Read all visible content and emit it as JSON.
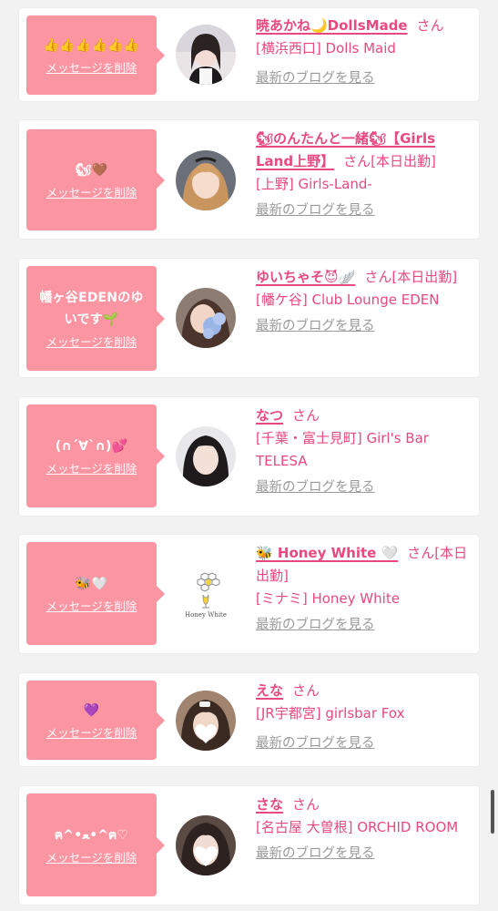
{
  "common": {
    "delete_label": "メッセージを削除",
    "san": "さん",
    "blog_link": "最新のブログを見る"
  },
  "items": [
    {
      "message": "👍👍👍👍👍👍",
      "name": "暁あかね🌙DollsMade",
      "status": "",
      "shop": "[横浜西口] Dolls Maid"
    },
    {
      "message": "🐿🤎",
      "name": "🐿のんたんと一緒🐿【Girls Land上野】",
      "status": "[本日出勤]",
      "shop": "[上野] Girls-Land-"
    },
    {
      "message": "幡ヶ谷EDENのゆいです🌱",
      "name": "ゆいちゃそ😈🪽",
      "status": "[本日出勤]",
      "shop": "[幡ケ谷] Club Lounge EDEN"
    },
    {
      "message": "(∩´∀`∩)💕",
      "name": "なつ",
      "status": "",
      "shop": "[千葉・富士見町] Girl's Bar TELESA"
    },
    {
      "message": "🐝🤍",
      "name": "🐝 Honey White 🤍",
      "status": "[本日出勤]",
      "shop": "[ミナミ] Honey White"
    },
    {
      "message": "💜",
      "name": "えな",
      "status": "",
      "shop": "[JR宇都宮] girlsbar Fox"
    },
    {
      "message": "ฅ^•ﻌ•^ฅ♡",
      "name": "さな",
      "status": "",
      "shop": "[名古屋 大曽根] ORCHID ROOM"
    }
  ],
  "logos": {
    "honey_white_text": "Honey White"
  },
  "colors": {
    "accent": "#e8497f",
    "bubble": "#fa95a1",
    "muted": "#9a9a9a",
    "background": "#f2f2f2"
  }
}
